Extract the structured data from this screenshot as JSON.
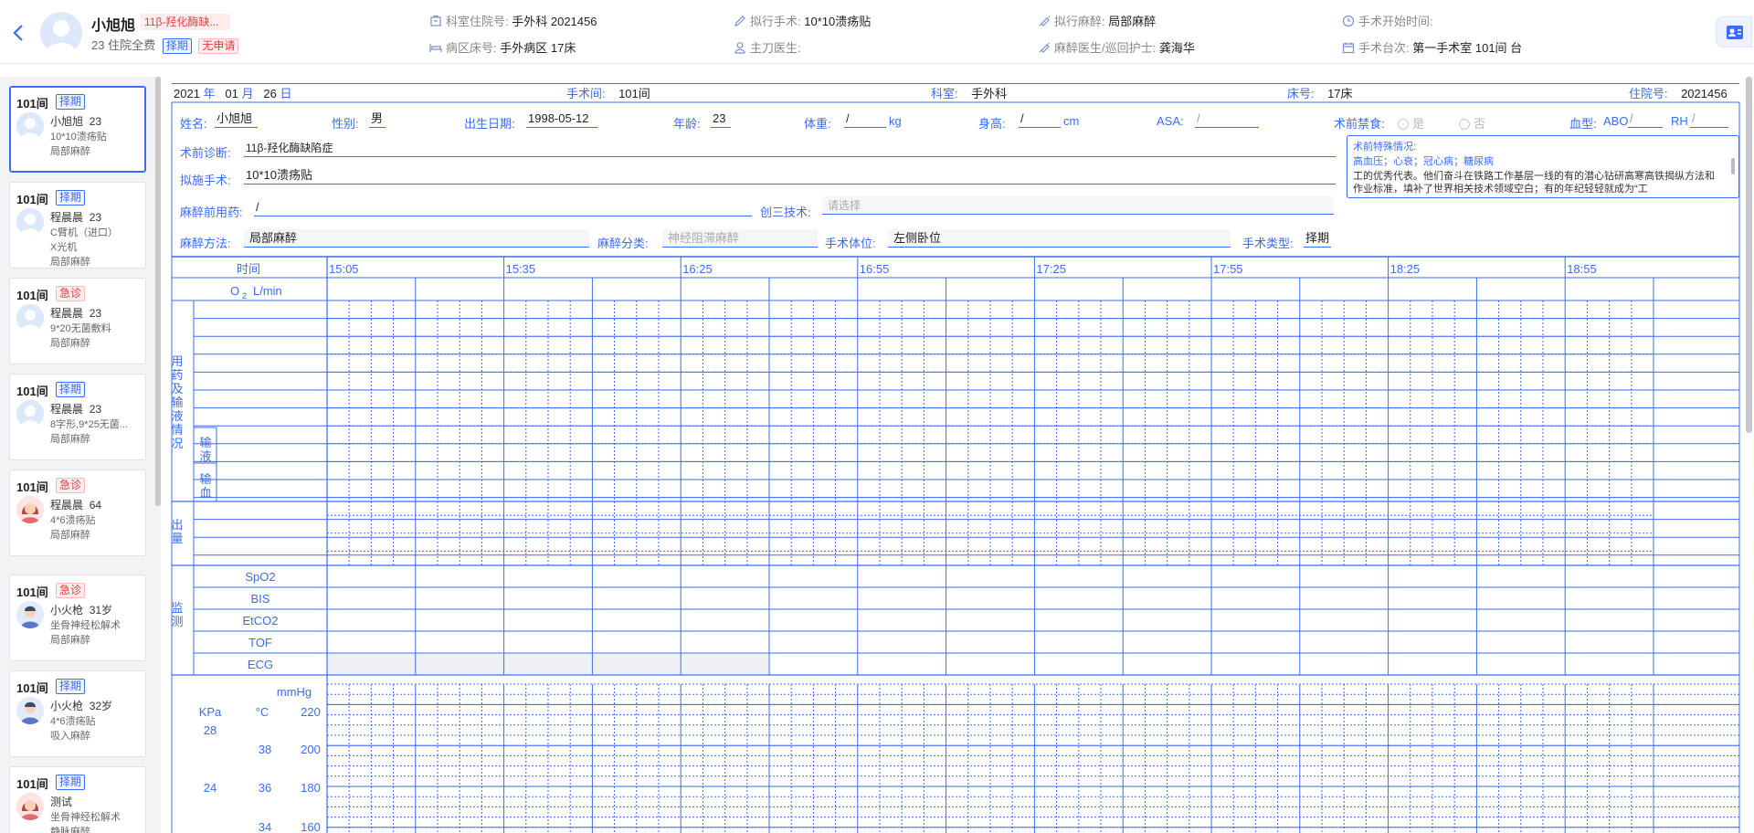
{
  "header": {
    "patient_name": "小旭旭",
    "diagnosis_tag": "11β-羟化酶缺...",
    "meta_prefix": "23 住院全费",
    "tag_type": "择期",
    "tag_apply": "无申请",
    "items": {
      "dept_label": "科室住院号:",
      "dept_value": "手外科 2021456",
      "op_label": "拟行手术:",
      "op_value": "10*10溃疡贴",
      "anes_label": "拟行麻醉:",
      "anes_value": "局部麻醉",
      "start_label": "手术开始时间:",
      "start_value": "",
      "ward_label": "病区床号:",
      "ward_value": "手外病区 17床",
      "surgeon_label": "主刀医生:",
      "surgeon_value": "",
      "anes_doc_label": "麻醉医生/巡回护士:",
      "anes_doc_value": "龚海华",
      "room_label": "手术台次:",
      "room_value": "第一手术室 101间 台"
    },
    "icons": [
      "building-icon",
      "pen-icon",
      "syringe-icon",
      "clock-icon",
      "bed-icon",
      "person-icon",
      "syringe-icon",
      "calendar-icon",
      "contact-card-icon"
    ]
  },
  "sidebar": {
    "cards": [
      {
        "room": "101间",
        "tag": "择期",
        "tag_color": "blue",
        "name": "小旭旭",
        "age": "23",
        "op": "10*10溃疡贴",
        "op2": "",
        "anes": "局部麻醉",
        "avatar": "male",
        "selected": true
      },
      {
        "room": "101间",
        "tag": "择期",
        "tag_color": "blue",
        "name": "程晨晨",
        "age": "23",
        "op": "C臂机（进口）",
        "op2": "X光机",
        "anes": "局部麻醉",
        "avatar": "male",
        "selected": false
      },
      {
        "room": "101间",
        "tag": "急诊",
        "tag_color": "red",
        "name": "程晨晨",
        "age": "23",
        "op": "9*20无菌敷料",
        "op2": "",
        "anes": "局部麻醉",
        "avatar": "male",
        "selected": false
      },
      {
        "room": "101间",
        "tag": "择期",
        "tag_color": "blue",
        "name": "程晨晨",
        "age": "23",
        "op": "8字形,9*25无菌...",
        "op2": "",
        "anes": "局部麻醉",
        "avatar": "male",
        "selected": false
      },
      {
        "room": "101间",
        "tag": "急诊",
        "tag_color": "red",
        "name": "程晨晨",
        "age": "64",
        "op": "4*6溃疡贴",
        "op2": "",
        "anes": "局部麻醉",
        "avatar": "female",
        "selected": false
      },
      {
        "room": "101间",
        "tag": "急诊",
        "tag_color": "red",
        "name": "小火枪",
        "age": "31岁",
        "op": "坐骨神经松解术",
        "op2": "",
        "anes": "局部麻醉",
        "avatar": "male2",
        "selected": false
      },
      {
        "room": "101间",
        "tag": "择期",
        "tag_color": "blue",
        "name": "小火枪",
        "age": "32岁",
        "op": "4*6溃疡贴",
        "op2": "",
        "anes": "吸入麻醉",
        "avatar": "male2",
        "selected": false
      },
      {
        "room": "101间",
        "tag": "择期",
        "tag_color": "blue",
        "name": "测试",
        "age": "",
        "op": "坐骨神经松解术",
        "op2": "",
        "anes": "静脉麻醉",
        "avatar": "female",
        "selected": false
      }
    ]
  },
  "record": {
    "date_year": "2021",
    "year_unit": "年",
    "date_month": "01",
    "month_unit": "月",
    "date_day": "26",
    "day_unit": "日",
    "room_label": "手术间:",
    "room_value": "101间",
    "dept_label": "科室:",
    "dept_value": "手外科",
    "bed_label": "床号:",
    "bed_value": "17床",
    "hosp_label": "住院号:",
    "hosp_value": "2021456",
    "name_label": "姓名:",
    "name_value": "小旭旭",
    "sex_label": "性别:",
    "sex_value": "男",
    "dob_label": "出生日期:",
    "dob_value": "1998-05-12",
    "age_label": "年龄:",
    "age_value": "23",
    "weight_label": "体重:",
    "weight_value": "/",
    "weight_unit": "kg",
    "height_label": "身高:",
    "height_value": "/",
    "height_unit": "cm",
    "asa_label": "ASA:",
    "asa_value": "/",
    "fast_label": "术前禁食:",
    "fast_yes": "是",
    "fast_no": "否",
    "blood_label": "血型:",
    "abo_label": "ABO",
    "abo_value": "/",
    "rh_label": "RH",
    "rh_value": "/",
    "prediag_label": "术前诊断:",
    "prediag_value": "11β-羟化酶缺陷症",
    "planop_label": "拟施手术:",
    "planop_value": "10*10溃疡贴",
    "premed_label": "麻醉前用药:",
    "premed_value": "/",
    "wound_label": "创三技术:",
    "wound_placeholder": "请选择",
    "method_label": "麻醉方法:",
    "method_value": "局部麻醉",
    "class_label": "麻醉分类:",
    "class_value": "神经阻滞麻醉",
    "pos_label": "手术体位:",
    "pos_value": "左侧卧位",
    "optype_label": "手术类型:",
    "optype_value": "择期",
    "special": {
      "title": "术前特殊情况:",
      "conditions": "高血压；心衰；冠心病；糖尿病",
      "text": "工的优秀代表。他们奋斗在铁路工作基层一线的有的潜心钻研高寒高铁揭纵方法和作业标准，填补了世界相关技术领域空白；有的年纪轻轻就成为“工"
    }
  },
  "chart": {
    "time_label": "时间",
    "o2_label": "O",
    "o2_sub": "2",
    "o2_unit": "L/min",
    "times": [
      "15:05",
      "15:35",
      "16:25",
      "16:55",
      "17:25",
      "17:55",
      "18:25",
      "18:55"
    ],
    "section_drug": "用药及输液情况",
    "sub_infusion": "输液",
    "sub_blood": "输血",
    "section_output": "出量",
    "section_monitor": "监测",
    "monitors": [
      "SpO2",
      "BIS",
      "EtCO2",
      "TOF",
      "ECG"
    ],
    "unit_mmhg": "mmHg",
    "unit_kpa": "KPa",
    "unit_c": "°C",
    "kpa_ticks": [
      "28",
      "24"
    ],
    "c_ticks": [
      "38",
      "36",
      "34"
    ],
    "mmhg_ticks": [
      "220",
      "200",
      "180",
      "160"
    ]
  },
  "colors": {
    "accent": "#3b6cf6",
    "urgent": "#e23c3c"
  }
}
